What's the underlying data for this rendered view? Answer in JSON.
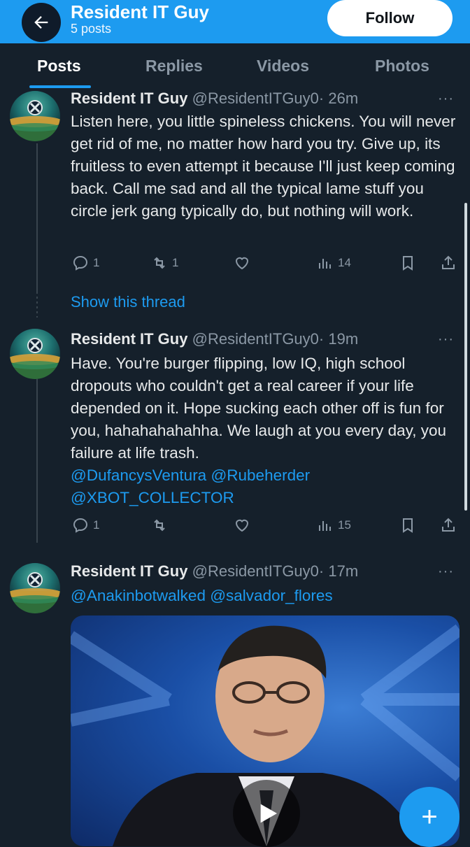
{
  "header": {
    "title": "Resident IT Guy",
    "post_count": "5 posts",
    "follow_label": "Follow"
  },
  "tabs": [
    {
      "label": "Posts",
      "active": true
    },
    {
      "label": "Replies",
      "active": false
    },
    {
      "label": "Videos",
      "active": false
    },
    {
      "label": "Photos",
      "active": false
    }
  ],
  "tweets": [
    {
      "name": "Resident IT Guy",
      "handle": "@ResidentITGuy0",
      "time": "· 26m",
      "text": "Listen here, you little spineless chickens. You will never get rid of me, no matter how hard you try. Give up, its fruitless to even attempt it because I'll just keep coming back. Call me sad and all the typical lame stuff you circle jerk gang typically do, but nothing will work.",
      "replies": "1",
      "reposts": "1",
      "likes": "",
      "views": "14"
    },
    {
      "name": "Resident IT Guy",
      "handle": "@ResidentITGuy0",
      "time": "· 19m",
      "text": "Have. You're burger flipping, low IQ, high school dropouts who couldn't get a real career if your life depended on it. Hope sucking each other off is fun for you, hahahahahahha. We laugh at you every day, you failure at life trash.",
      "mentions_line1": "@DufancysVentura @Rubeherder",
      "mentions_line2": "@XBOT_COLLECTOR",
      "replies": "1",
      "reposts": "",
      "likes": "",
      "views": "15"
    },
    {
      "name": "Resident IT Guy",
      "handle": "@ResidentITGuy0",
      "time": "· 17m",
      "mentions": "@Anakinbotwalked @salvador_flores"
    }
  ],
  "show_thread_label": "Show this thread",
  "more_glyph": "···",
  "fab_glyph": "+",
  "colors": {
    "accent": "#1d9bf0",
    "background": "#15202b",
    "muted_text": "#8b98a5"
  },
  "icons": [
    "back-arrow-icon",
    "reply-icon",
    "repost-icon",
    "like-icon",
    "views-icon",
    "bookmark-icon",
    "share-icon",
    "play-icon",
    "compose-icon"
  ]
}
